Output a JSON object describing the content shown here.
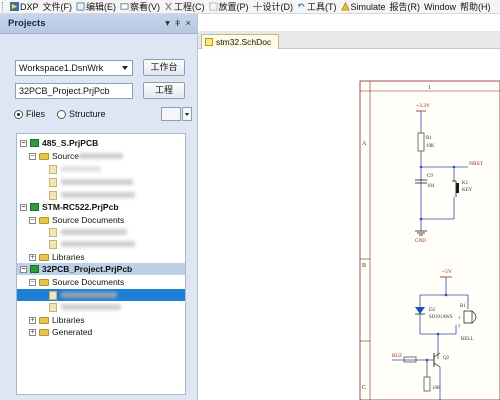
{
  "menubar": {
    "items": [
      {
        "label": "DXP"
      },
      {
        "label": "文件(F)"
      },
      {
        "label": "编辑(E)"
      },
      {
        "label": "察看(V)"
      },
      {
        "label": "工程(C)"
      },
      {
        "label": "放置(P)"
      },
      {
        "label": "设计(D)"
      },
      {
        "label": "工具(T)"
      },
      {
        "label": "Simulate"
      },
      {
        "label": "报告(R)"
      },
      {
        "label": "Window"
      },
      {
        "label": "帮助(H)"
      }
    ]
  },
  "panel": {
    "title": "Projects",
    "workspace_value": "Workspace1.DsnWrk",
    "workspace_button": "工作台",
    "project_value": "32PCB_Project.PrjPcb",
    "project_button": "工程",
    "radio_files": "Files",
    "radio_structure": "Structure"
  },
  "tree": {
    "p1": "485_S.PrjPCB",
    "p1_source": "Source",
    "p2": "STM-RC522.PrjPcb",
    "p2_source": "Source Documents",
    "p2_libraries": "Libraries",
    "p3": "32PCB_Project.PrjPcb",
    "p3_source": "Source Documents",
    "p3_libraries": "Libraries",
    "p3_generated": "Generated"
  },
  "document": {
    "tab_label": "stm32.SchDoc"
  },
  "schematic": {
    "vcc1": "+3.3V",
    "r1_ref": "R1",
    "r1_val": "10K",
    "nrst": "NRST",
    "c9_ref": "C9",
    "c9_val": "104",
    "k1_ref": "K1",
    "k1_val": "KEY",
    "gnd": "GND",
    "vcc2": "+5V",
    "b1_ref": "B1",
    "d2_ref": "D2",
    "d2_val": "SD101AWS",
    "bell": "BELL",
    "buz": "BUZ",
    "q2_ref": "Q2",
    "r_bot_val": "10K",
    "border_top_1": "1",
    "border_a": "A",
    "border_b": "B",
    "border_c": "C"
  }
}
